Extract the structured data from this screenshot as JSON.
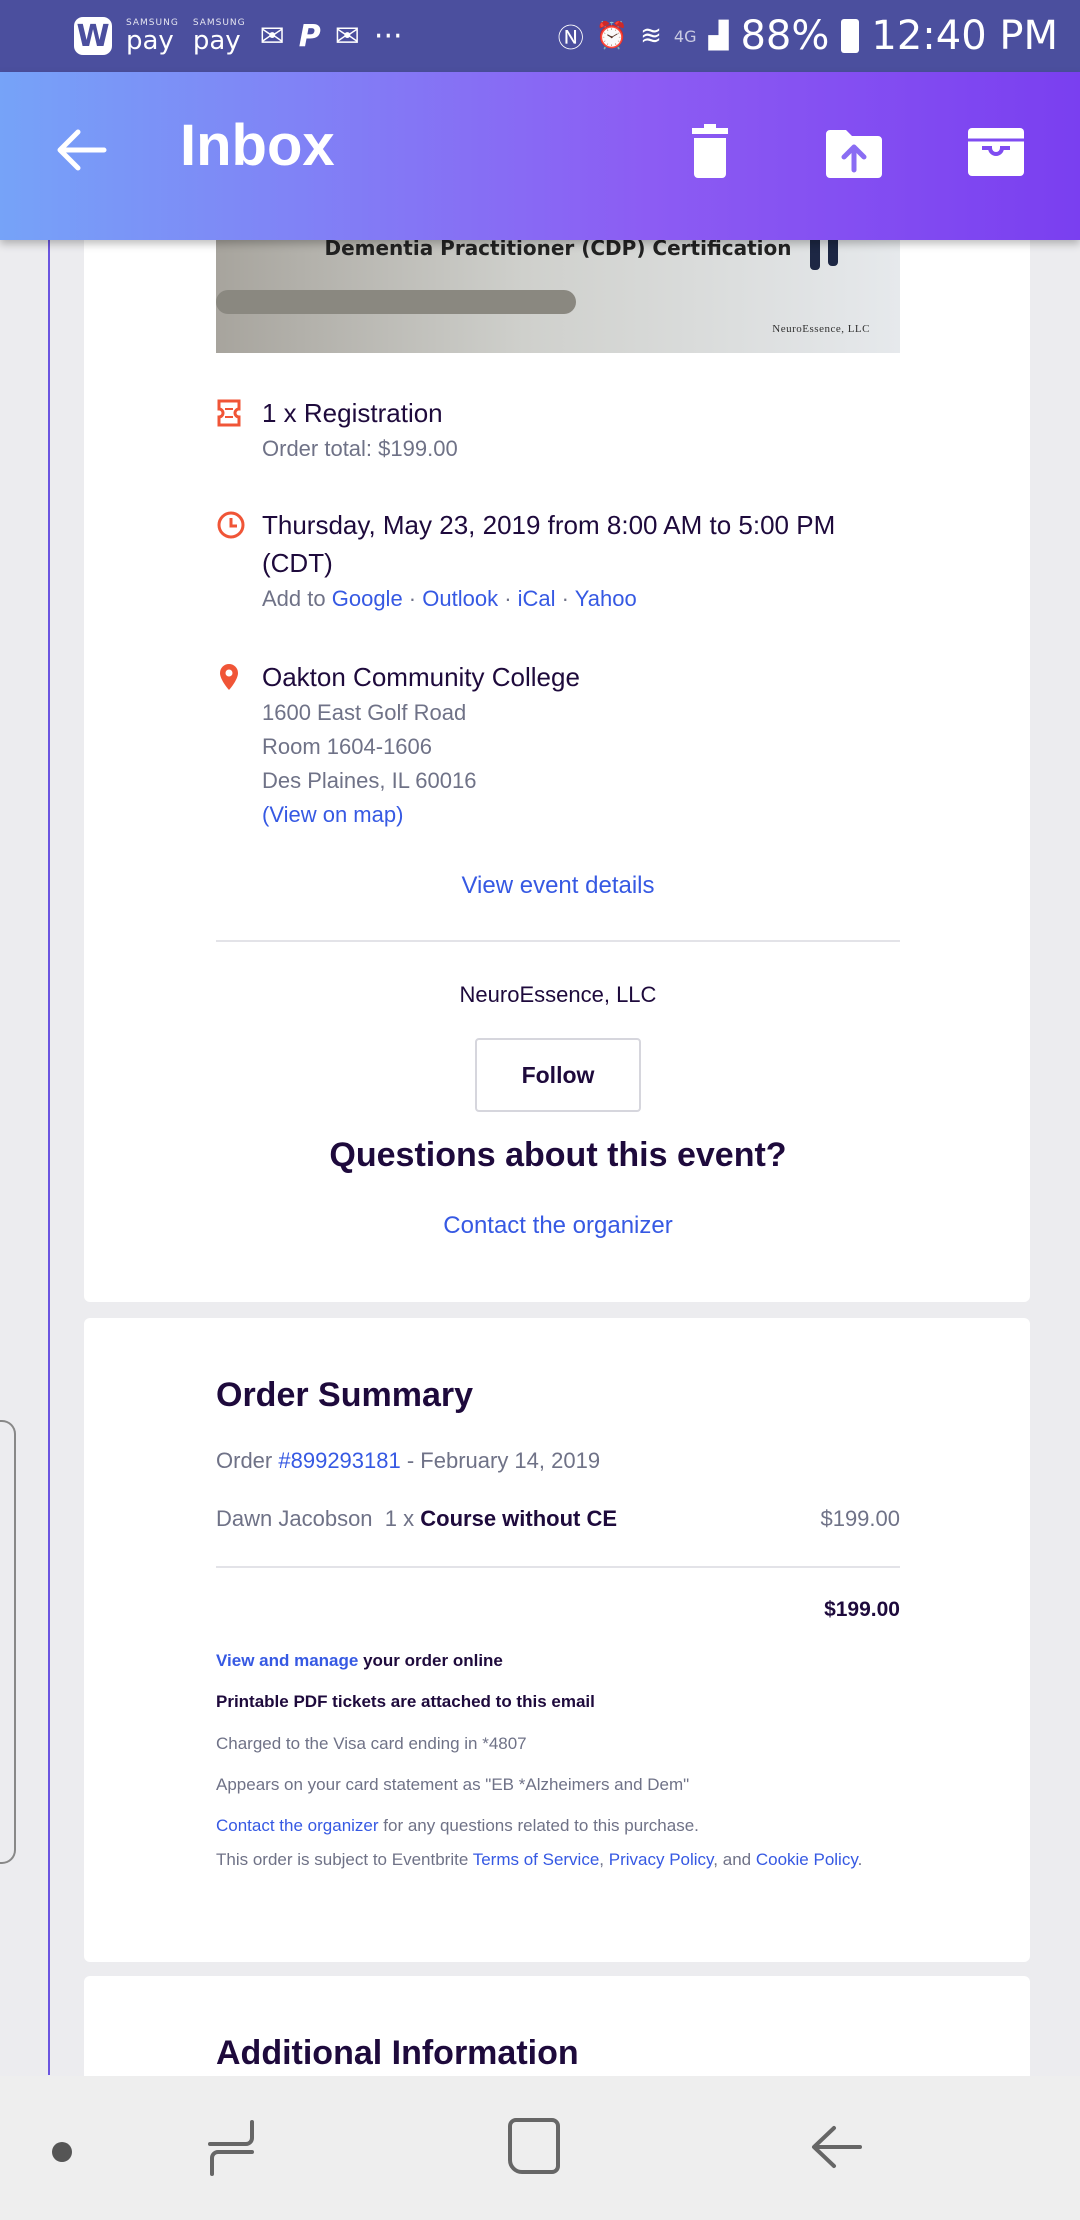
{
  "status_bar": {
    "w_app": "W",
    "pay1_small": "SAMSUNG",
    "pay1": "pay",
    "pay2_small": "SAMSUNG",
    "pay2": "pay",
    "more": "···",
    "network": "4G",
    "battery": "88%",
    "time": "12:40 PM"
  },
  "app_bar": {
    "title": "Inbox"
  },
  "hero": {
    "caption": "Dementia Practitioner (CDP) Certification",
    "brand": "NeuroEssence, LLC"
  },
  "event": {
    "registration": "1 x Registration",
    "order_total": "Order total: $199.00",
    "date": "Thursday, May 23, 2019 from 8:00 AM to 5:00 PM (CDT)",
    "add_to": "Add to",
    "calendars": [
      "Google",
      "Outlook",
      "iCal",
      "Yahoo"
    ],
    "separator": " · ",
    "venue": "Oakton Community College",
    "address1": "1600 East Golf Road",
    "address2": "Room 1604-1606",
    "address3": "Des Plaines, IL 60016",
    "map_link": "(View on map)",
    "details_link": "View event details",
    "organizer": "NeuroEssence, LLC",
    "follow": "Follow",
    "questions": "Questions about this event?",
    "contact": "Contact the organizer"
  },
  "order": {
    "title": "Order Summary",
    "order_prefix": "Order",
    "order_number": "#899293181",
    "order_date": " - February 14, 2019",
    "attendee": "Dawn Jacobson",
    "qty": "1 x",
    "ticket": "Course without CE",
    "price": "$199.00",
    "total": "$199.00",
    "manage_link": "View and manage",
    "manage_rest": " your order online",
    "pdf": "Printable PDF tickets are attached to this email",
    "charged": "Charged to the Visa card ending in *4807",
    "statement": "Appears on your card statement as \"EB *Alzheimers and Dem\"",
    "contact_link": "Contact the organizer",
    "contact_rest": " for any questions related to this purchase.",
    "terms_pre": "This order is subject to Eventbrite ",
    "tos": "Terms of Service",
    "comma": ", ",
    "privacy": "Privacy Policy",
    "and": ", and ",
    "cookie": "Cookie Policy",
    "period": "."
  },
  "additional": {
    "title": "Additional Information"
  },
  "colors": {
    "accent": "#3659e3",
    "brand_gradient_start": "#76a3f8",
    "brand_gradient_end": "#7a3ff0",
    "icon_orange": "#f05537"
  }
}
